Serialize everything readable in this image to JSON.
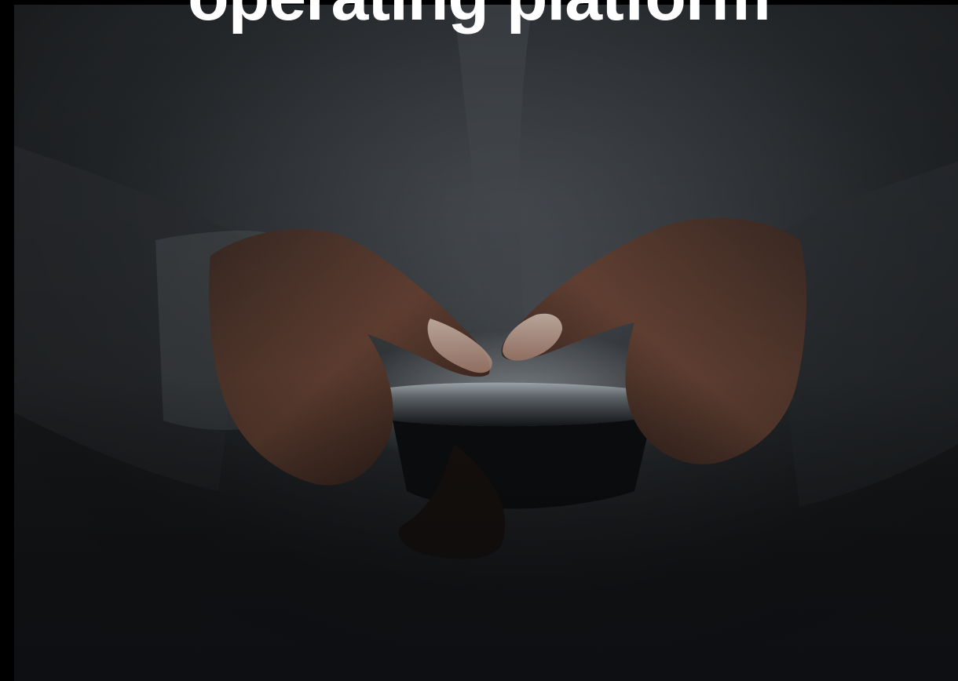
{
  "headline": {
    "text": "operating platform"
  },
  "photo": {
    "subject": "hands-holding-glowing-smartphone"
  },
  "colors": {
    "background": "#000000",
    "headline": "#ffffff",
    "shirt": "#3a3e42",
    "skin": "#6e4a3a",
    "phone_glow": "#c9d3d8"
  }
}
